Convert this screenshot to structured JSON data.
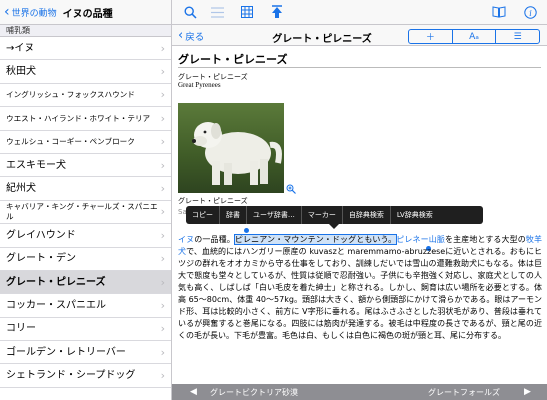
{
  "left": {
    "back_label": "世界の動物",
    "title": "イヌの品種",
    "section": "哺乳類",
    "items": [
      {
        "label": "→イヌ",
        "small": false,
        "selected": false
      },
      {
        "label": "秋田犬",
        "small": false,
        "selected": false
      },
      {
        "label": "イングリッシュ・フォックスハウンド",
        "small": true,
        "selected": false
      },
      {
        "label": "ウエスト・ハイランド・ホワイト・テリア",
        "small": true,
        "selected": false
      },
      {
        "label": "ウェルシュ・コーギー・ペンブローク",
        "small": true,
        "selected": false
      },
      {
        "label": "エスキモー犬",
        "small": false,
        "selected": false
      },
      {
        "label": "紀州犬",
        "small": false,
        "selected": false
      },
      {
        "label": "キャバリア・キング・チャールズ・スパニエル",
        "small": true,
        "selected": false
      },
      {
        "label": "グレイハウンド",
        "small": false,
        "selected": false
      },
      {
        "label": "グレート・デン",
        "small": false,
        "selected": false
      },
      {
        "label": "グレート・ピレニーズ",
        "small": false,
        "selected": true
      },
      {
        "label": "コッカー・スパニエル",
        "small": false,
        "selected": false
      },
      {
        "label": "コリー",
        "small": false,
        "selected": false
      },
      {
        "label": "ゴールデン・レトリーバー",
        "small": false,
        "selected": false
      },
      {
        "label": "シェトランド・シープドッグ",
        "small": false,
        "selected": false
      }
    ]
  },
  "toolbar": {
    "icons": [
      "search-icon",
      "list-icon",
      "table-icon",
      "pin-icon",
      "book-icon",
      "info-icon"
    ]
  },
  "subnav": {
    "back_label": "戻る",
    "title": "グレート・ピレニーズ",
    "seg": [
      "＋",
      "Aₐ",
      "☰"
    ]
  },
  "article": {
    "headword": "グレート・ピレニーズ",
    "sub_ja": "グレート・ピレニーズ",
    "sub_en": "Great Pyrenees",
    "caption": "グレート・ピレニーズ",
    "caption2": "Sal"
  },
  "context_menu": [
    "コピー",
    "辞書",
    "ユーザ辞書…",
    "マーカー",
    "自辞典検索",
    "LV辞典検索"
  ],
  "body": {
    "p1_a": "イヌ",
    "p1_b": "の一品種。",
    "p1_hl": "ピレニアン・マウンテン・ドッグともいう。",
    "p1_link2": "ピレネー山脈",
    "p1_c": "を主産地とする大型の",
    "p1_link3": "牧羊犬",
    "p1_d": "で、血統的にはハンガリー原産の kuvaszと maremmamo-abruzzeseに近いとされる。おもにヒツジの群れをオオカミから守る仕事をしており、訓練しだいでは雪山の遭難救助犬にもなる。体は巨大で態度も堂々としているが、性質は従順で忍耐強い。子供にも辛抱強く対応し、家庭犬としての人気も高く、しばしば「白い毛皮を着た紳士」と称される。しかし、飼育は広い場所を必要とする。体高 65〜80cm、体重 40〜57kg。頭部は大きく、額から側頭部にかけて滑らかである。眼はアーモンド形、耳は比較的小さく、前方に V字形に垂れる。尾はふさふさとした羽状毛があり、普段は垂れているが興奮すると巻尾になる。四肢には筋肉が発達する。被毛は中程度の長さであるが、頸と尾の近くの毛が長い。下毛が豊富。毛色は白、もしくは白色に褐色の斑が頸と耳、尾に分布する。"
  },
  "bottom": {
    "prev": "グレートビクトリア砂漠",
    "next": "グレートフォールズ"
  }
}
